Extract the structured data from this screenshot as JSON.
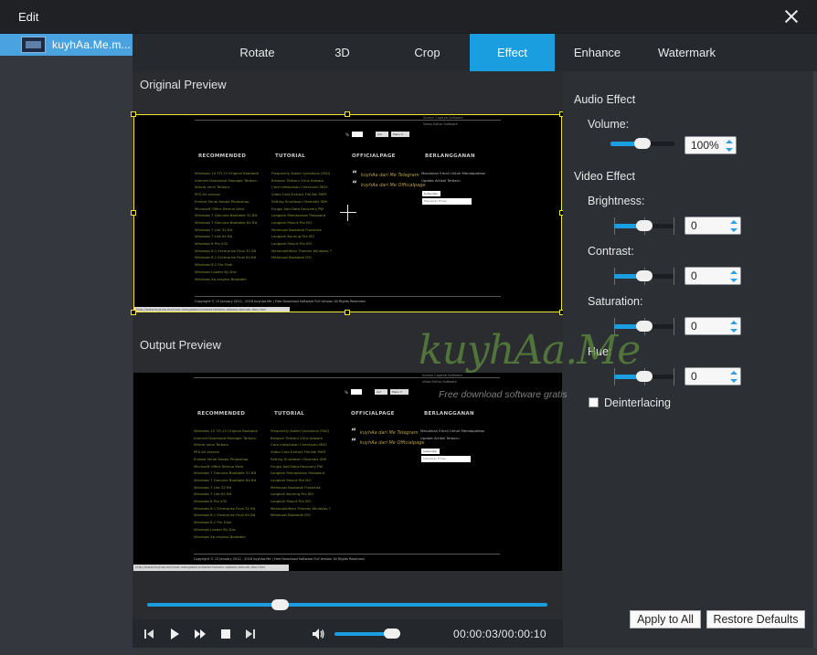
{
  "window": {
    "title": "Edit"
  },
  "file": {
    "name": "kuyhAa.Me.m..."
  },
  "tabs": [
    {
      "label": "Rotate"
    },
    {
      "label": "3D"
    },
    {
      "label": "Crop"
    },
    {
      "label": "Effect",
      "active": true
    },
    {
      "label": "Enhance"
    },
    {
      "label": "Watermark"
    }
  ],
  "preview": {
    "original_label": "Original Preview",
    "output_label": "Output Preview"
  },
  "site": {
    "headers": [
      "RECOMMENDED",
      "TUTORIAL",
      "OFFICIALPAGE",
      "BERLANGGANAN"
    ],
    "recommended": [
      "Windows 10 T.R.13 Original Bootable",
      "Internet Download Manager Terbaru",
      "Winrar versi Terbaru",
      "PES All version",
      "Embed Serial Adobe Photoshop",
      "Microsoft Office Semua Versi",
      "Windows 7 Genuine Bootable 32 Bit",
      "Windows 7 Genuine Bootable 64 Bit",
      "Windows 7 Lite 32 Bit",
      "Windows 7 Lite 64 Bit",
      "Windows 8 Pro X32",
      "Windows 8.1 Enterprise Final 32 Bit",
      "Windows 8.1 Enterprise Final 64 Bit",
      "Windows 8.1 Pro Final",
      "Windows Loader By Daz",
      "Windows Xp original Bootable"
    ],
    "tutorial": [
      "Frequently Asked Questions (FAQ)",
      "Browser Terbaru Virus Adware",
      "Cara melakukan Checksum MD5",
      "Video Cara Extract File Bei PART",
      "Setting Shutdown Otomatis IDM",
      "Fungsi Add Data Recovery PW",
      "Langkah Memasukan Password",
      "Langkah Mount File ISO",
      "Membuat Bootable Flashdisk",
      "Langkah Burning File ISO",
      "Langkah Mount File ISO",
      "Menonaktifkan Themes Windows 7",
      "Membuat Bootable ISO"
    ],
    "official": [
      "kuyhAa dari Me Telegram",
      "kuyhAa dari Me Officialpage"
    ],
    "subscribe": [
      "Masukkan Email Untuk Mendapatkan",
      "Update Artikel Terbaru"
    ],
    "subscribe_button": "Subscribe",
    "email_placeholder": "Masukkan Email...",
    "go_button": "Go!",
    "menu_button": "Menu ▾",
    "topright": [
      "Screen Capture Software",
      "Video Editor Software"
    ],
    "copyright": "Copyright © 13 January 2012 - 2018 kuyhAa.Me | Free Download Software Full Version All Rights Reserved.",
    "status": "http://www.kuyhaa.me/cara-mengatasi-browser-terbaru-adware-bancak-dan.html"
  },
  "player": {
    "time": "00:00:03/00:00:10",
    "seek_fraction": 0.33,
    "volume_fraction": 0.85
  },
  "audio": {
    "section_label": "Audio Effect",
    "volume_label": "Volume:",
    "volume_value": "100%",
    "volume_fraction": 0.5
  },
  "video": {
    "section_label": "Video Effect",
    "brightness_label": "Brightness:",
    "brightness_value": "0",
    "contrast_label": "Contrast:",
    "contrast_value": "0",
    "saturation_label": "Saturation:",
    "saturation_value": "0",
    "hue_label": "Hue:",
    "hue_value": "0",
    "deinterlacing_label": "Deinterlacing",
    "deinterlacing_checked": false
  },
  "buttons": {
    "apply_all": "Apply to All",
    "restore": "Restore Defaults"
  },
  "watermark": {
    "brand": "kuyhAa.Me",
    "tagline": "Free download software gratis"
  },
  "colors": {
    "accent": "#1a9ee0",
    "crop_frame": "#f0e43a",
    "titlebar": "#1f2124"
  }
}
